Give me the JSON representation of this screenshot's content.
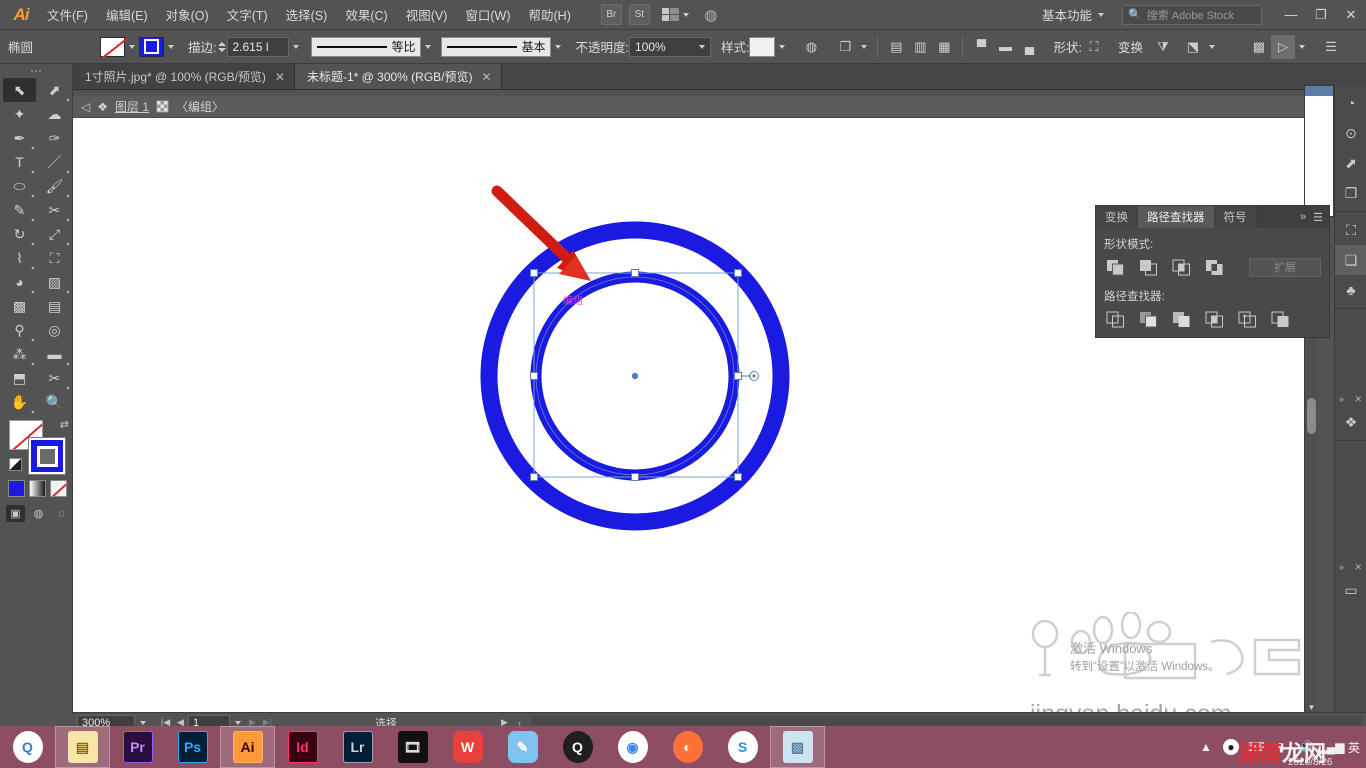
{
  "app": {
    "name": "Adobe Illustrator",
    "logo_text": "Ai",
    "accent": "#ff9a3c",
    "artwork_blue": "#1a1ae0",
    "taskbar_color": "#8d4e63"
  },
  "menubar": {
    "items": [
      {
        "label": "文件(F)"
      },
      {
        "label": "编辑(E)"
      },
      {
        "label": "对象(O)"
      },
      {
        "label": "文字(T)"
      },
      {
        "label": "选择(S)"
      },
      {
        "label": "效果(C)"
      },
      {
        "label": "视图(V)"
      },
      {
        "label": "窗口(W)"
      },
      {
        "label": "帮助(H)"
      }
    ],
    "bridge_label": "Br",
    "stock_label": "St",
    "workspace": "基本功能",
    "search_placeholder": "搜索 Adobe Stock",
    "window_buttons": {
      "minimize": "—",
      "restore": "❐",
      "close": "✕"
    }
  },
  "optionbar": {
    "object_type": "椭圆",
    "fill_label": "填色",
    "stroke_label": "描边:",
    "stroke_weight": "2.615 l",
    "stroke_profile": "等比",
    "brush_definition": "基本",
    "opacity_label": "不透明度:",
    "opacity_value": "100%",
    "style_label": "样式:",
    "shape_label": "形状:",
    "transform_label": "变换",
    "align_label": "对齐"
  },
  "tabs": [
    {
      "label": "1寸照片.jpg* @ 100% (RGB/预览)",
      "active": false,
      "close": "✕"
    },
    {
      "label": "未标题-1* @ 300% (RGB/预览)",
      "active": true,
      "close": "✕"
    }
  ],
  "breadcrumb": {
    "back_icon": "◁",
    "layer_label": "图层 1",
    "group_label": "〈编组〉"
  },
  "toolbar": {
    "tools": [
      {
        "name": "selection-tool",
        "glyph": "⬉",
        "selected": true
      },
      {
        "name": "direct-selection-tool",
        "glyph": "⬈",
        "selected": false
      },
      {
        "name": "magic-wand-tool",
        "glyph": "✦",
        "selected": false
      },
      {
        "name": "lasso-tool",
        "glyph": "☁",
        "selected": false
      },
      {
        "name": "pen-tool",
        "glyph": "✒",
        "selected": false
      },
      {
        "name": "curvature-tool",
        "glyph": "✑",
        "selected": false
      },
      {
        "name": "type-tool",
        "glyph": "T",
        "selected": false
      },
      {
        "name": "line-segment-tool",
        "glyph": "／",
        "selected": false
      },
      {
        "name": "ellipse-tool",
        "glyph": "⬭",
        "selected": false
      },
      {
        "name": "paintbrush-tool",
        "glyph": "🖌",
        "selected": false
      },
      {
        "name": "shaper-tool",
        "glyph": "✎",
        "selected": false
      },
      {
        "name": "scissors-tool",
        "glyph": "✂",
        "selected": false
      },
      {
        "name": "rotate-tool",
        "glyph": "↻",
        "selected": false
      },
      {
        "name": "scale-tool",
        "glyph": "⤢",
        "selected": false
      },
      {
        "name": "width-tool",
        "glyph": "⌇",
        "selected": false
      },
      {
        "name": "free-transform-tool",
        "glyph": "⛶",
        "selected": false
      },
      {
        "name": "shape-builder-tool",
        "glyph": "◕",
        "selected": false
      },
      {
        "name": "perspective-grid-tool",
        "glyph": "▨",
        "selected": false
      },
      {
        "name": "mesh-tool",
        "glyph": "▩",
        "selected": false
      },
      {
        "name": "gradient-tool",
        "glyph": "▤",
        "selected": false
      },
      {
        "name": "eyedropper-tool",
        "glyph": "⚲",
        "selected": false
      },
      {
        "name": "blend-tool",
        "glyph": "◎",
        "selected": false
      },
      {
        "name": "symbol-sprayer-tool",
        "glyph": "⁂",
        "selected": false
      },
      {
        "name": "column-graph-tool",
        "glyph": "▬",
        "selected": false
      },
      {
        "name": "artboard-tool",
        "glyph": "⬒",
        "selected": false
      },
      {
        "name": "slice-tool",
        "glyph": "✂",
        "selected": false
      },
      {
        "name": "hand-tool",
        "glyph": "✋",
        "selected": false
      },
      {
        "name": "zoom-tool",
        "glyph": "🔍",
        "selected": false
      }
    ],
    "fill_state": "none",
    "stroke_state": "blue",
    "color_modes": [
      "color",
      "gradient",
      "none"
    ],
    "screen_modes": [
      "normal",
      "full-menu",
      "full"
    ]
  },
  "pathfinder_panel": {
    "tabs": [
      {
        "label": "变换",
        "active": false
      },
      {
        "label": "路径查找器",
        "active": true
      },
      {
        "label": "符号",
        "active": false
      }
    ],
    "collapse_icon": "»",
    "menu_icon": "☰",
    "shape_modes_label": "形状模式:",
    "shape_modes": [
      "unite",
      "minus-front",
      "intersect",
      "exclude"
    ],
    "expand_button": "扩展",
    "pathfinders_label": "路径查找器:",
    "pathfinders": [
      "divide",
      "trim",
      "merge",
      "crop",
      "outline",
      "minus-back"
    ]
  },
  "dock": {
    "icons": [
      {
        "name": "color-guide-icon",
        "glyph": "◔"
      },
      {
        "name": "color-icon",
        "glyph": "⊙"
      },
      {
        "name": "export-icon",
        "glyph": "⬈"
      },
      {
        "name": "layers-compare-icon",
        "glyph": "❐"
      },
      {
        "name": "transform-icon",
        "glyph": "⛶"
      },
      {
        "name": "pathfinder-icon",
        "glyph": "❏",
        "active": true
      },
      {
        "name": "symbols-icon",
        "glyph": "♣"
      },
      {
        "name": "layers-icon",
        "glyph": "❖"
      },
      {
        "name": "gradient-icon",
        "glyph": "▭"
      }
    ],
    "collapse": "»",
    "close": "✕"
  },
  "statusbar": {
    "zoom_level": "300%",
    "page_number": "1",
    "status_text": "选择",
    "first_icon": "|◀",
    "prev_icon": "◀",
    "next_icon": "▶",
    "last_icon": "▶|"
  },
  "canvas": {
    "artwork_name": "两个同心圆环",
    "smart_guide_label": "编组",
    "annotation": "red-arrow",
    "selection": {
      "handles": 8,
      "center_point": true,
      "rotate_handle": true
    }
  },
  "overlays": {
    "windows_activate_title": "激活 Windows",
    "windows_activate_sub": "转到“设置”以激活 Windows。",
    "baidu_watermark": "jingyan.baidu.com",
    "site_watermark_red": "湖南",
    "site_watermark_white": "龙网",
    "date": "2020/8/26"
  },
  "taskbar": {
    "items": [
      {
        "name": "browser-q-icon",
        "label": "Q",
        "bg": "#ffffff",
        "fg": "#2f7fd0",
        "open": false
      },
      {
        "name": "file-explorer-icon",
        "label": "▤",
        "bg": "#f5e6a8",
        "fg": "#8a6d1a",
        "open": true
      },
      {
        "name": "premiere-icon",
        "label": "Pr",
        "bg": "#2a0e3d",
        "fg": "#c28bff",
        "open": false
      },
      {
        "name": "photoshop-icon",
        "label": "Ps",
        "bg": "#001e36",
        "fg": "#31a8ff",
        "open": false
      },
      {
        "name": "illustrator-icon",
        "label": "Ai",
        "bg": "#330000",
        "fg": "#ff9a00",
        "open": true
      },
      {
        "name": "indesign-icon",
        "label": "Id",
        "bg": "#3a0012",
        "fg": "#ff3366",
        "open": false
      },
      {
        "name": "lightroom-icon",
        "label": "Lr",
        "bg": "#001e36",
        "fg": "#c8d5e0",
        "open": false
      },
      {
        "name": "video-player-icon",
        "label": "🎞",
        "bg": "#111111",
        "fg": "#dddddd",
        "open": false
      },
      {
        "name": "wps-icon",
        "label": "W",
        "bg": "#e8403a",
        "fg": "#ffffff",
        "open": false
      },
      {
        "name": "note-app-icon",
        "label": "✎",
        "bg": "#7fc4f0",
        "fg": "#ffffff",
        "open": false
      },
      {
        "name": "qq-icon",
        "label": "Q",
        "bg": "#1f1f1f",
        "fg": "#ffffff",
        "open": false
      },
      {
        "name": "chrome-icon",
        "label": "◉",
        "bg": "#ffffff",
        "fg": "#4285f4",
        "open": false
      },
      {
        "name": "firefox-icon",
        "label": "◐",
        "bg": "#ff7139",
        "fg": "#ffffff",
        "open": false
      },
      {
        "name": "sogou-icon",
        "label": "S",
        "bg": "#ffffff",
        "fg": "#1e9ad6",
        "open": false
      },
      {
        "name": "document-icon",
        "label": "▧",
        "bg": "#cfe4f2",
        "fg": "#5a7fa0",
        "open": true
      }
    ],
    "tray": {
      "expand": "▲",
      "icons": [
        "qq-tray-icon",
        "input-tray-icon",
        "battery-icon",
        "volume-icon",
        "network-icon"
      ],
      "ime": "英"
    }
  }
}
